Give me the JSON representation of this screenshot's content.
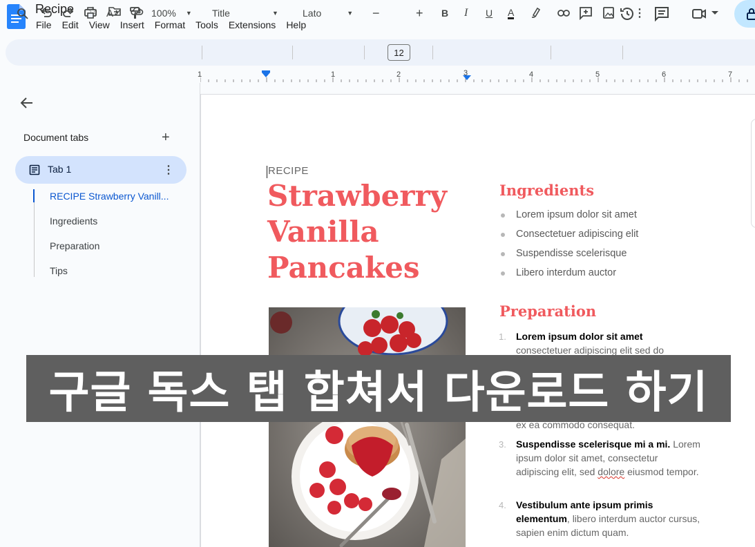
{
  "header": {
    "doc_title": "Recipe",
    "menu": [
      "File",
      "Edit",
      "View",
      "Insert",
      "Format",
      "Tools",
      "Extensions",
      "Help"
    ]
  },
  "toolbar": {
    "zoom": "100%",
    "style": "Title",
    "font": "Lato",
    "font_size": "12",
    "bold": "B",
    "italic": "I",
    "underline": "U",
    "text_color": "A"
  },
  "ruler": {
    "numbers": [
      "1",
      "1",
      "2",
      "3",
      "4",
      "5",
      "6",
      "7"
    ]
  },
  "sidebar": {
    "title": "Document tabs",
    "tab_label": "Tab 1",
    "outline": [
      "RECIPE Strawberry Vanill...",
      "Ingredients",
      "Preparation",
      "Tips"
    ]
  },
  "document": {
    "kicker": "RECIPE",
    "title_lines": [
      "Strawberry",
      "Vanilla",
      "Pancakes"
    ],
    "ingredients_heading": "Ingredients",
    "ingredients": [
      "Lorem ipsum dolor sit amet",
      "Consectetuer adipiscing elit",
      "Suspendisse scelerisque",
      "Libero interdum auctor"
    ],
    "preparation_heading": "Preparation",
    "steps": [
      {
        "num": "1.",
        "bold": "Lorem ipsum dolor sit amet",
        "rest": "consectetuer adipiscing elit sed do"
      },
      {
        "num": "",
        "bold": "",
        "rest": "ex ea commodo consequat."
      },
      {
        "num": "3.",
        "bold": "Suspendisse scelerisque mi a mi.",
        "rest_a": " Lorem ipsum dolor sit amet, consectetur adipiscing elit, sed ",
        "rest_squig": "dolore",
        "rest_b": " eiusmod tempor."
      },
      {
        "num": "4.",
        "bold": "Vestibulum ante ipsum primis elementum",
        "rest": ", libero interdum auctor cursus, sapien enim dictum quam."
      }
    ]
  },
  "banner": {
    "text": "구글 독스 탭 합쳐서 다운로드 하기"
  },
  "colors": {
    "accent": "#f05a5e",
    "tab_pill": "#d3e3fd",
    "link_blue": "#0b57d0",
    "banner_bg": "#5f5f5f"
  }
}
